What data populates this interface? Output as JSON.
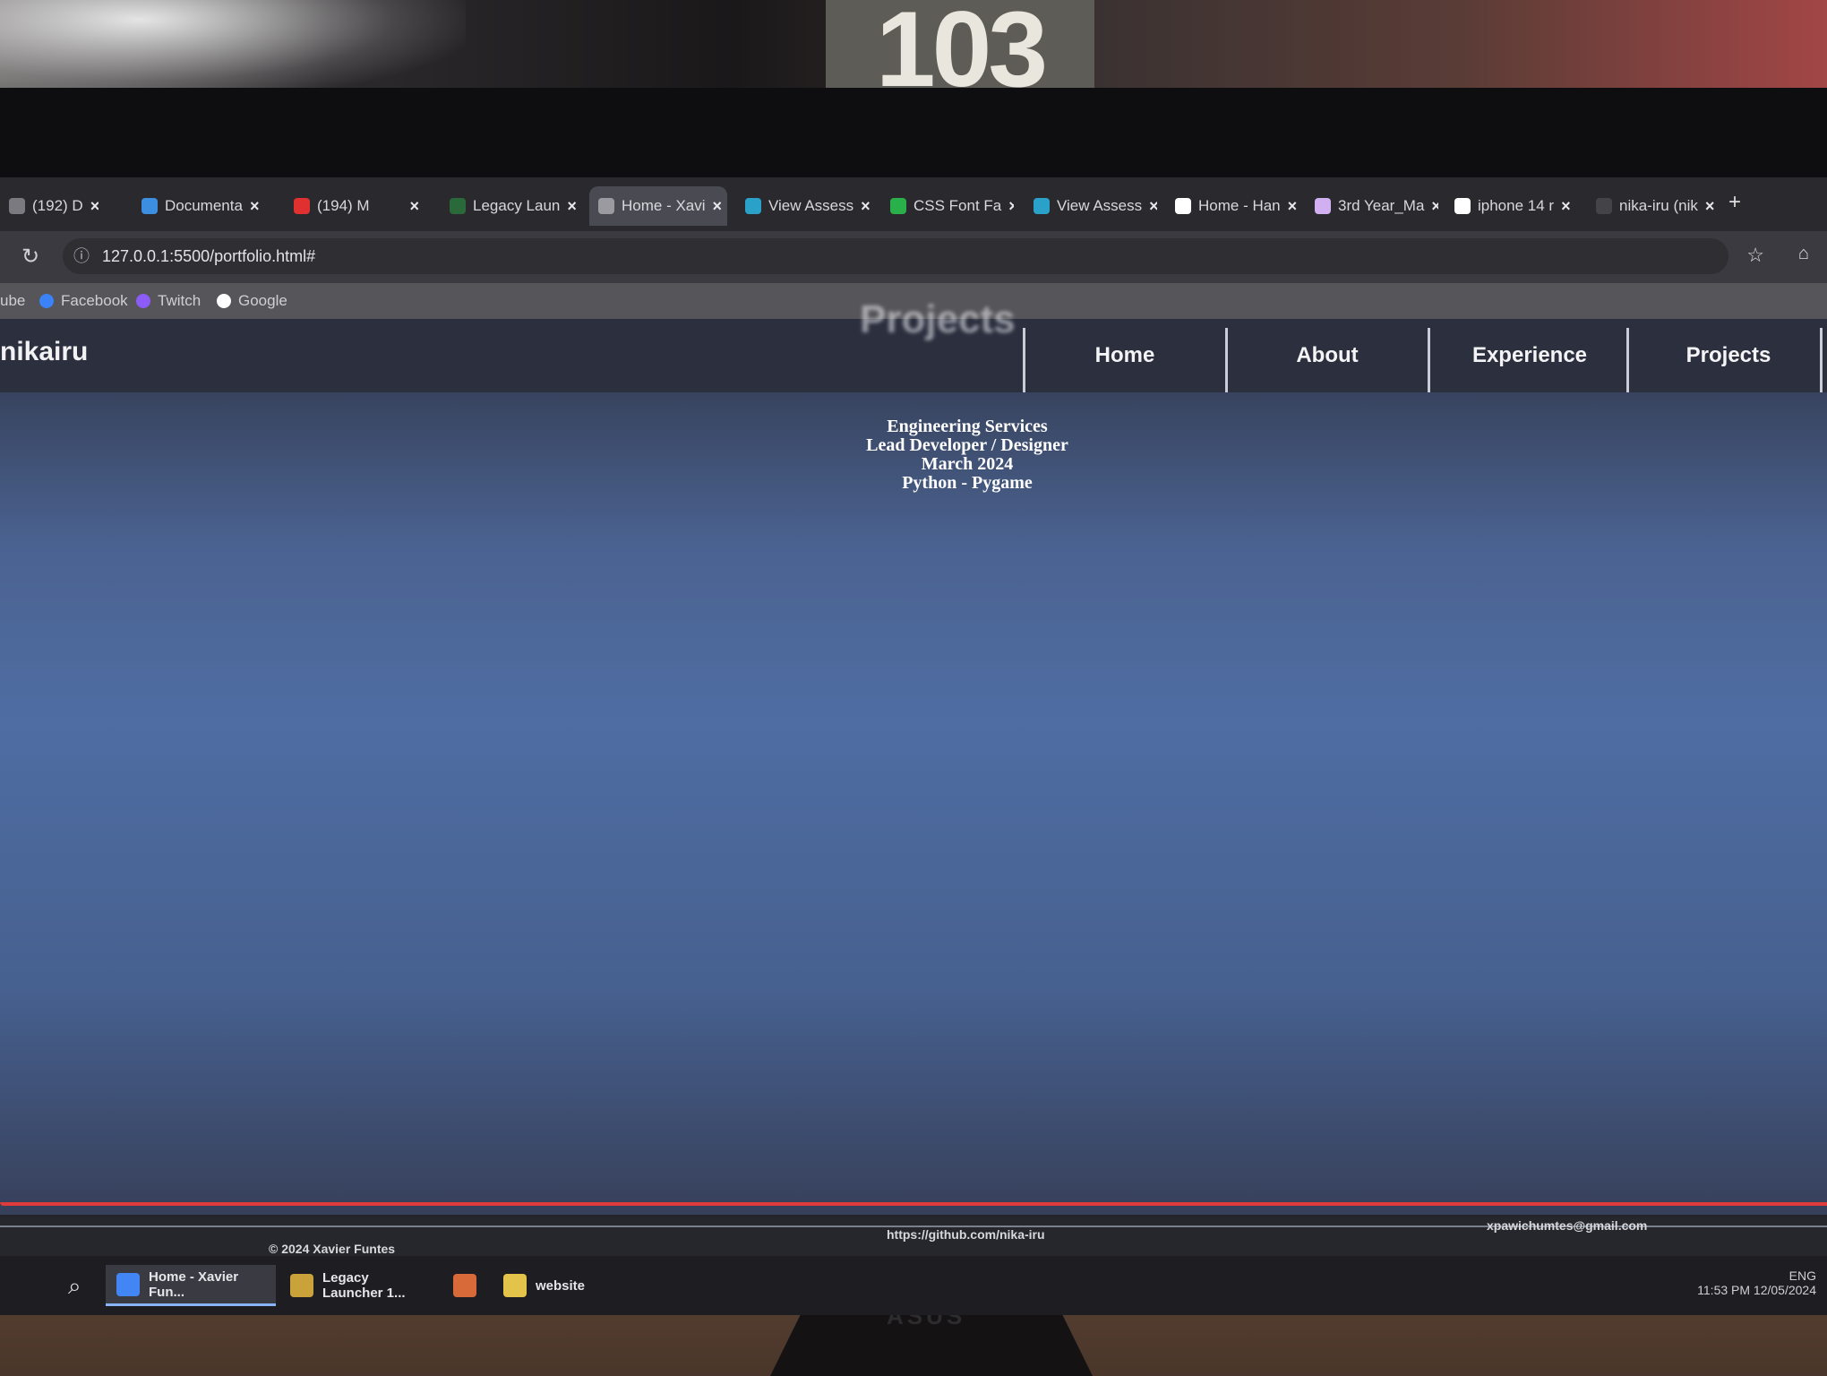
{
  "browser": {
    "tabs": [
      {
        "label": "(192) D",
        "favicon_color": "#7a7a80"
      },
      {
        "label": "Documenta",
        "favicon_color": "#3c8fe0"
      },
      {
        "label": "(194) M",
        "favicon_color": "#e03030"
      },
      {
        "label": "Legacy Laun",
        "favicon_color": "#2a6a3a"
      },
      {
        "label": "Home - Xavi",
        "favicon_color": "#9a9aa0",
        "active": true
      },
      {
        "label": "View Assess",
        "favicon_color": "#2aa1c8"
      },
      {
        "label": "CSS Font Fa",
        "favicon_color": "#2ab04a"
      },
      {
        "label": "View Assess",
        "favicon_color": "#2aa1c8"
      },
      {
        "label": "Home - Han",
        "favicon_color": "#ffffff"
      },
      {
        "label": "3rd Year_Ma",
        "favicon_color": "#d0b0f0"
      },
      {
        "label": "iphone 14 r",
        "favicon_color": "#ffffff"
      },
      {
        "label": "nika-iru (nik",
        "favicon_color": "#444448"
      }
    ],
    "new_tab_label": "+",
    "url": "127.0.0.1:5500/portfolio.html#",
    "bookmarks": [
      {
        "label": "ube",
        "color": "#e03030"
      },
      {
        "label": "Facebook",
        "color": "#3b82f6"
      },
      {
        "label": "Twitch",
        "color": "#8b5cf6"
      },
      {
        "label": "Google",
        "color": "#ffffff"
      }
    ]
  },
  "page": {
    "logo": "nikairu",
    "ghost_title": "Projects",
    "nav": [
      "Home",
      "About",
      "Experience",
      "Projects"
    ],
    "project_lines": [
      "Engineering Services",
      "Lead Developer / Designer",
      "March 2024",
      "Python - Pygame"
    ],
    "accent_color": "#e03a3a"
  },
  "footer": {
    "copyright": "© 2024 Xavier Funtes",
    "github": "https://github.com/nika-iru",
    "email": "xpawichumtes@gmail.com"
  },
  "taskbar": {
    "items": [
      {
        "label": "Home - Xavier Fun...",
        "icon_color": "#4285f4",
        "active": true
      },
      {
        "label": "Legacy Launcher 1...",
        "icon_color": "#c9a23a"
      },
      {
        "label": "",
        "icon_color": "#d86a3a"
      },
      {
        "label": "website",
        "icon_color": "#e3c34a"
      }
    ],
    "tray_time": "11:53 PM",
    "tray_date": "12/05/2024",
    "tray_lang": "ENG"
  },
  "room": {
    "poster_number": "103",
    "monitor_brand": "ASUS"
  }
}
